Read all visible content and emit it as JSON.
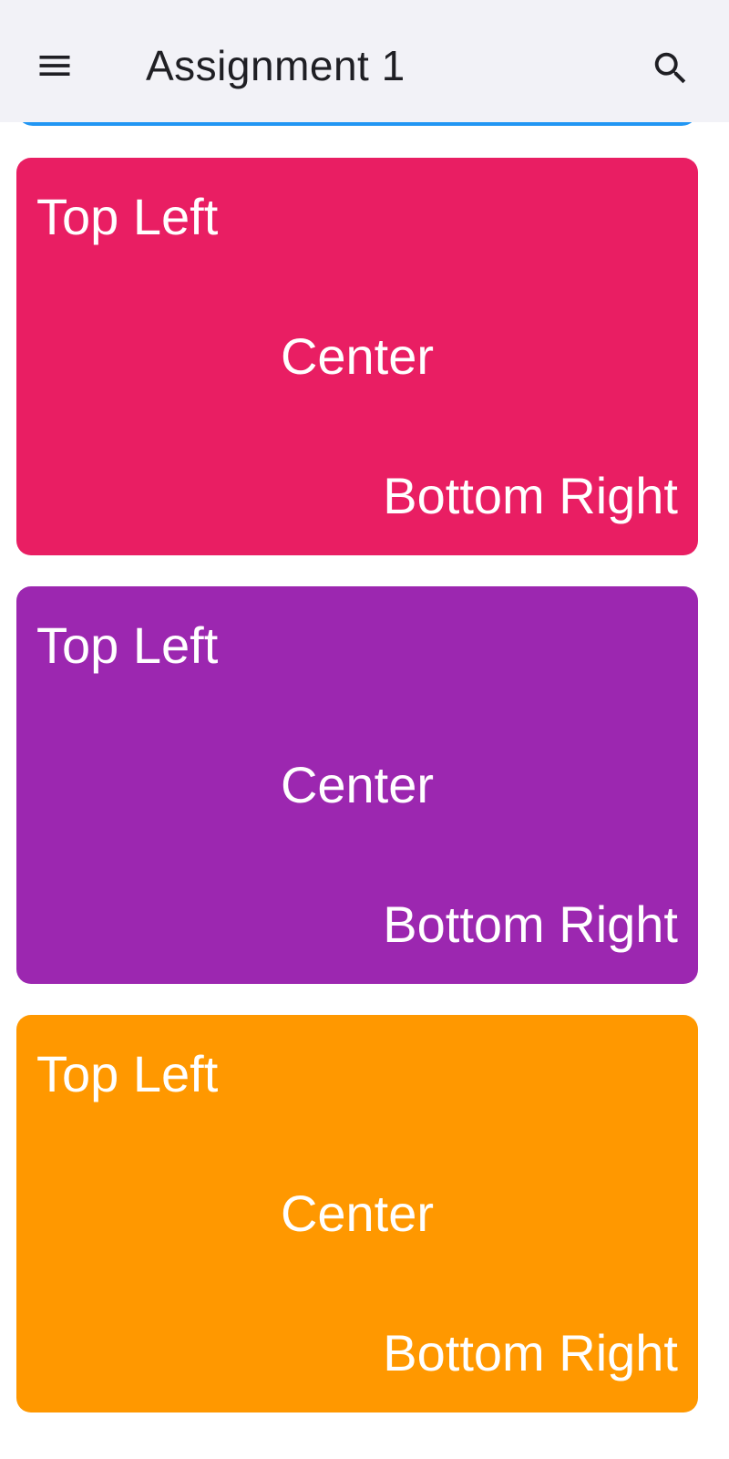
{
  "app_bar": {
    "title": "Assignment 1",
    "menu_icon": "hamburger-menu-icon",
    "search_icon": "search-icon",
    "background": "#f2f2f7"
  },
  "partial_card_color": "#2196f3",
  "cards": [
    {
      "top_left": "Top Left",
      "center": "Center",
      "bottom_right": "Bottom Right",
      "color": "#e91e63"
    },
    {
      "top_left": "Top Left",
      "center": "Center",
      "bottom_right": "Bottom Right",
      "color": "#9c27b0"
    },
    {
      "top_left": "Top Left",
      "center": "Center",
      "bottom_right": "Bottom Right",
      "color": "#ff9800"
    }
  ]
}
